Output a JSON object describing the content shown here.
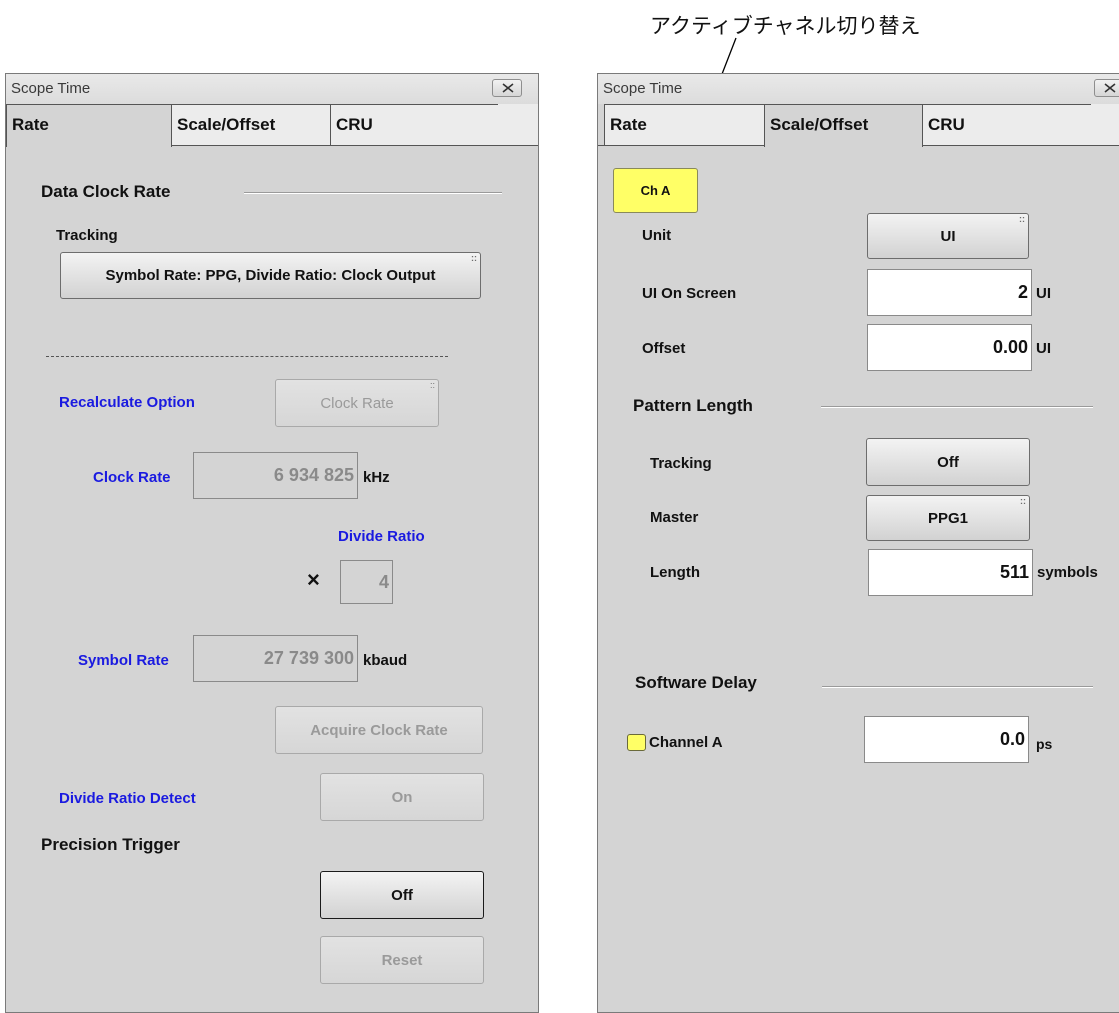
{
  "annotation": {
    "text": "アクティブチャネル切り替え"
  },
  "left": {
    "title": "Scope Time",
    "tabs": [
      "Rate",
      "Scale/Offset",
      "CRU"
    ],
    "data_clock_rate_heading": "Data Clock Rate",
    "tracking_label": "Tracking",
    "tracking_button": "Symbol Rate: PPG, Divide Ratio: Clock Output",
    "recalculate_label": "Recalculate Option",
    "recalculate_button": "Clock Rate",
    "clock_rate_label": "Clock Rate",
    "clock_rate_value": "6 934 825",
    "clock_rate_unit": "kHz",
    "divide_ratio_label": "Divide Ratio",
    "multiply_sign": "×",
    "divide_ratio_value": "4",
    "symbol_rate_label": "Symbol Rate",
    "symbol_rate_value": "27 739 300",
    "symbol_rate_unit": "kbaud",
    "acquire_button": "Acquire Clock Rate",
    "divide_detect_label": "Divide Ratio Detect",
    "divide_detect_button": "On",
    "precision_trigger_heading": "Precision Trigger",
    "precision_trigger_button": "Off",
    "reset_button": "Reset"
  },
  "right": {
    "title": "Scope Time",
    "tabs": [
      "Rate",
      "Scale/Offset",
      "CRU"
    ],
    "channel_button": "Ch A",
    "unit_label": "Unit",
    "unit_button": "UI",
    "ui_on_screen_label": "UI On Screen",
    "ui_on_screen_value": "2",
    "ui_on_screen_unit": "UI",
    "offset_label": "Offset",
    "offset_value": "0.00",
    "offset_unit": "UI",
    "pattern_length_heading": "Pattern Length",
    "pl_tracking_label": "Tracking",
    "pl_tracking_button": "Off",
    "master_label": "Master",
    "master_button": "PPG1",
    "length_label": "Length",
    "length_value": "511",
    "length_unit": "symbols",
    "software_delay_heading": "Software Delay",
    "channel_a_label": "Channel A",
    "channel_a_value": "0.0",
    "channel_a_unit": "ps"
  }
}
